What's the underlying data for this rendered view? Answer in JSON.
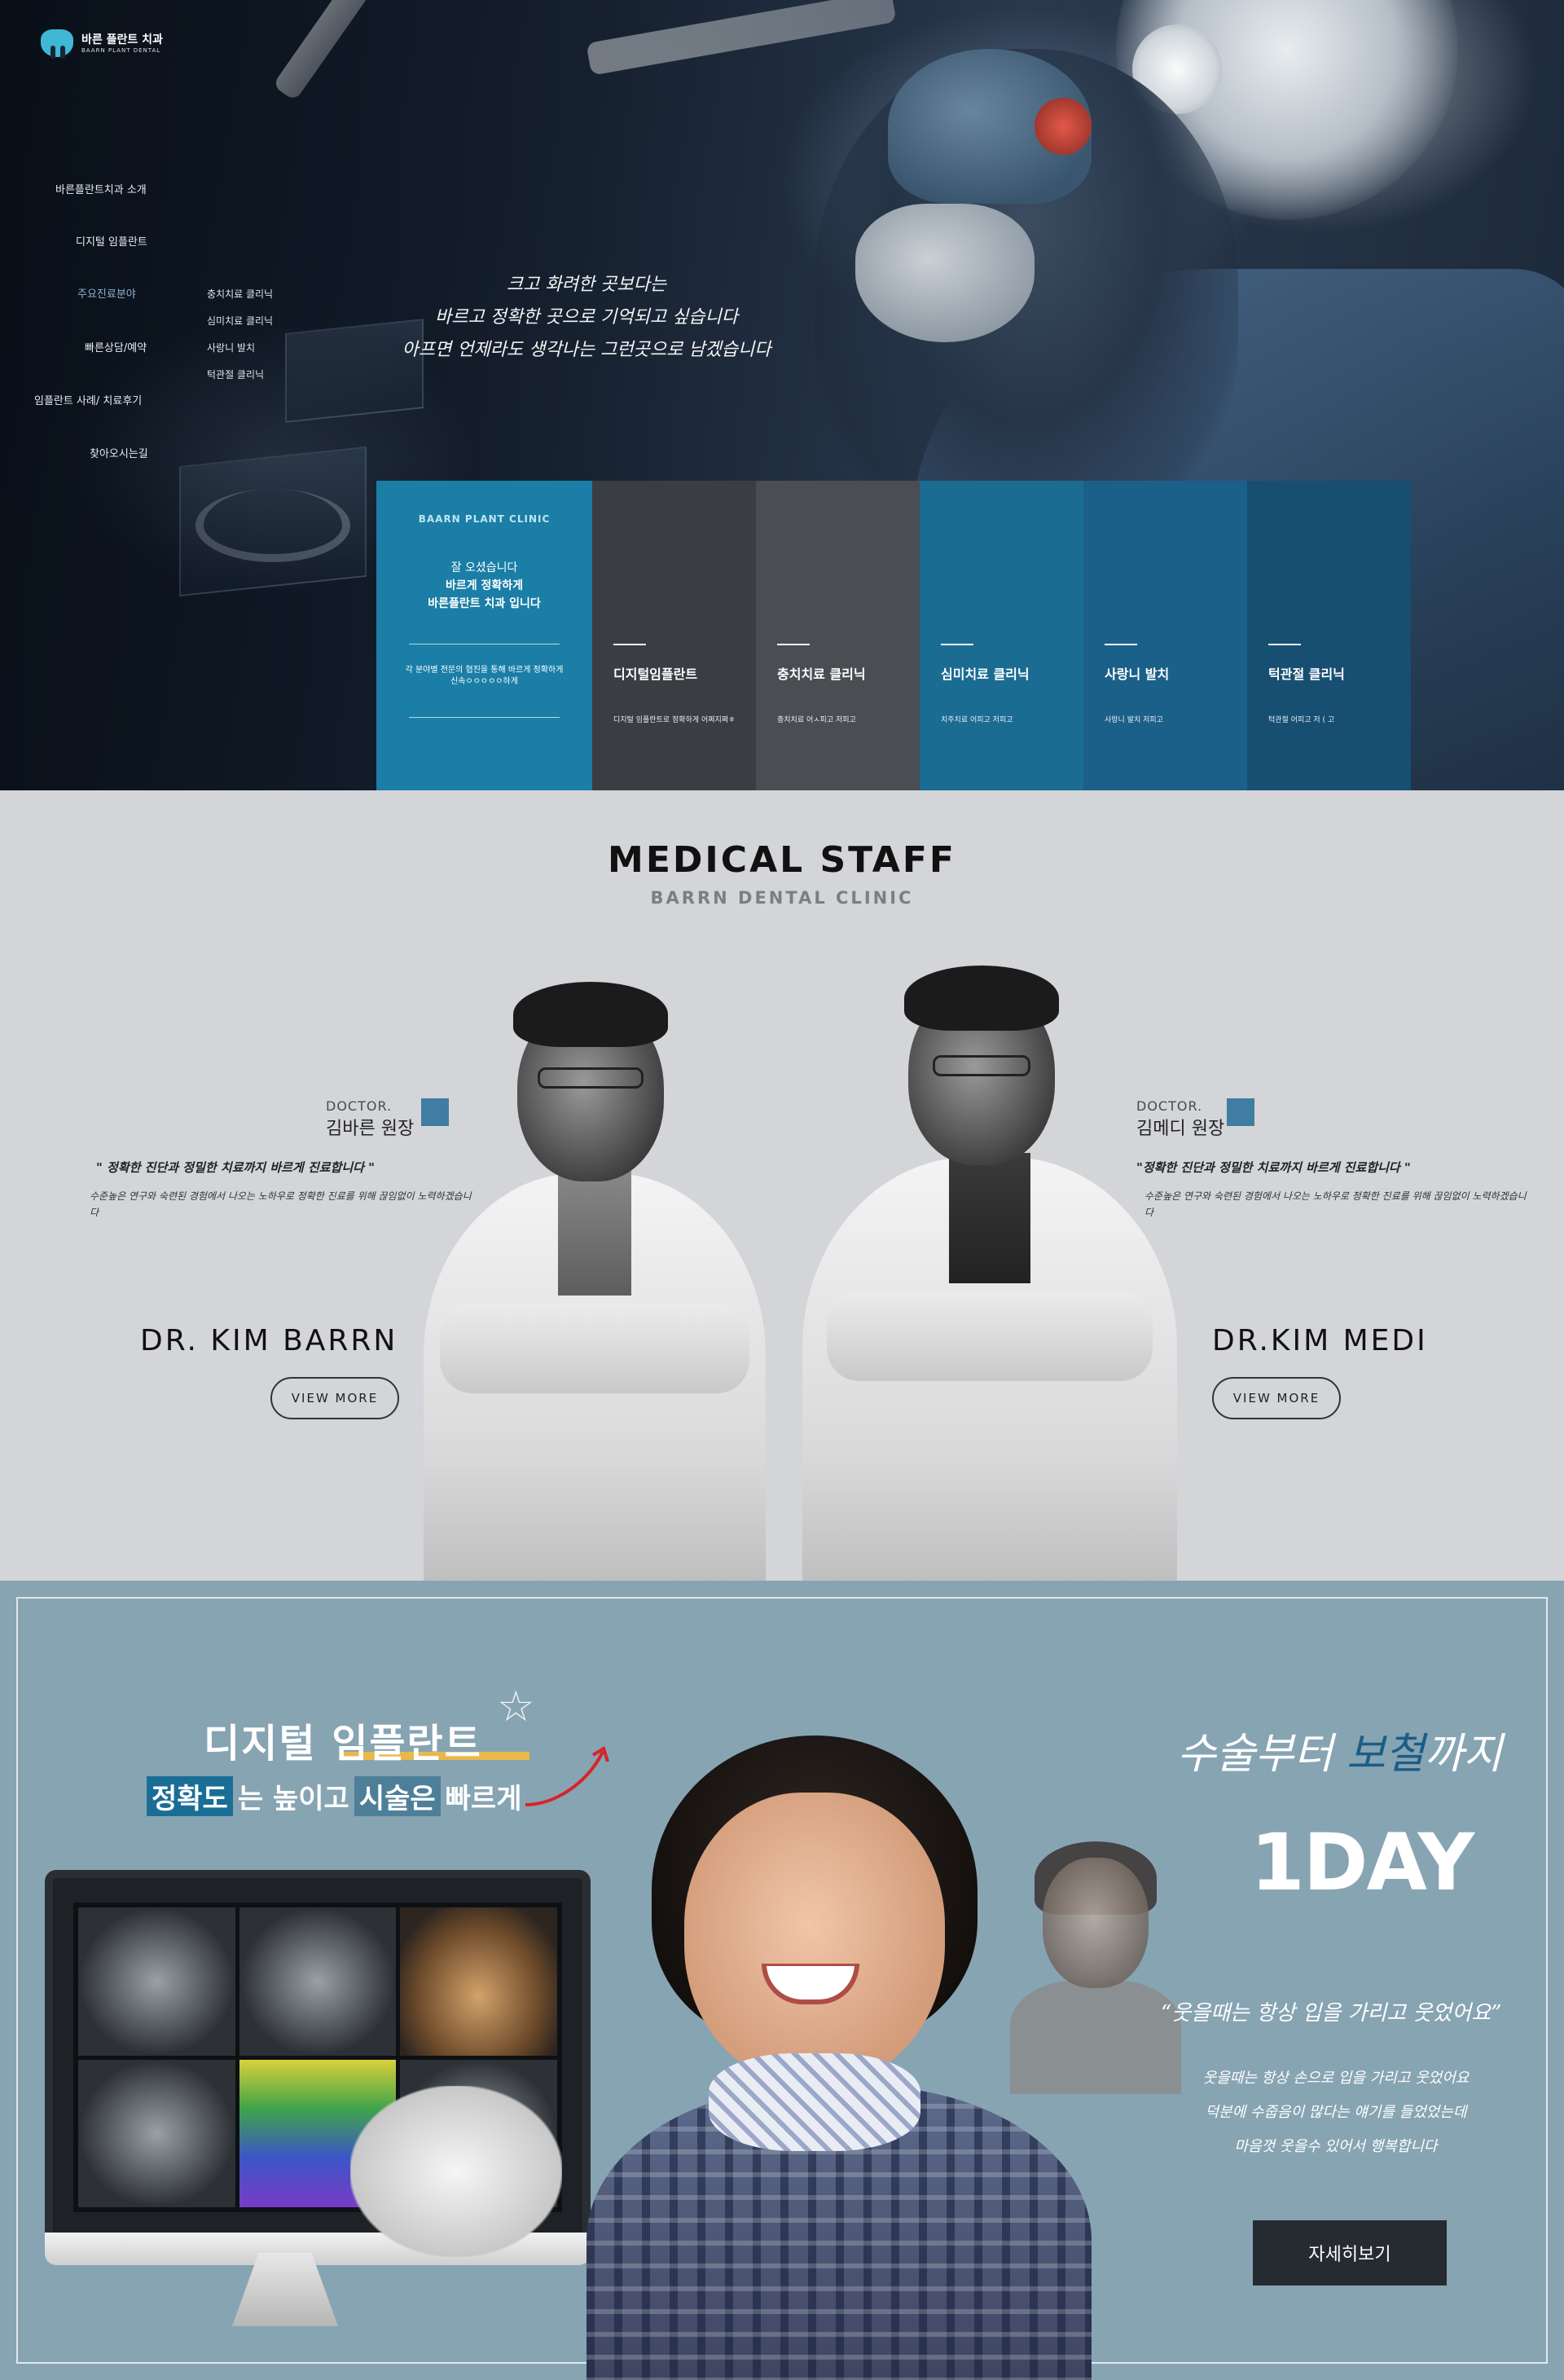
{
  "brand": {
    "kr": "바른 플란트 치과",
    "en": "BAARN PLANT DENTAL"
  },
  "nav": {
    "items": [
      "바른플란트치과 소개",
      "디지털 임플란트",
      "주요진료분야",
      "빠른상담/예약",
      "임플란트 사례/ 치료후기",
      "찾아오시는길"
    ],
    "sub_items": [
      "충치치료 클리닉",
      "심미치료 클리닉",
      "사랑니 발치",
      "턱관절 클리닉"
    ]
  },
  "hero": {
    "quote_lines": [
      "크고 화려한 곳보다는",
      "바르고 정확한 곳으로 기억되고 싶습니다",
      "아프면 언제라도 생각나는 그런곳으로 남겠습니다"
    ],
    "main_card": {
      "brand": "BAARN PLANT CLINIC",
      "l1": "잘 오셨습니다",
      "l2": "바르게 정확하게",
      "l3": "바른플란트 치과 입니다",
      "desc": "각 분야별 전문의 협진을 통해 바르게 정확하게 신속ㅇㅇㅇㅇㅇ하게"
    },
    "cards": [
      {
        "title": "디지털임플란트",
        "desc": "디지털 임플란트로 정확하게 어쩌지쩌ㅎ",
        "color": "#3a3d42"
      },
      {
        "title": "충치치료 클리닉",
        "desc": "충치치료 어ㅅ피고 저피고",
        "color": "#4a4d52"
      },
      {
        "title": "심미치료 클리닉",
        "desc": "치주치료 어피고 저피고",
        "color": "#1a6c93"
      },
      {
        "title": "사랑니 발치",
        "desc": "사랑니 발치 저피고",
        "color": "#1b6089"
      },
      {
        "title": "턱관절 클리닉",
        "desc": "턱관절 어피고 저 ( 고",
        "color": "#174f73"
      }
    ]
  },
  "staff": {
    "title": "MEDICAL STAFF",
    "subtitle": "BARRN DENTAL CLINIC",
    "doctors": [
      {
        "label": "DOCTOR.",
        "name": "김바른 원장",
        "quote": "\" 정확한 진단과 정밀한 치료까지 바르게 진료합니다 \"",
        "desc": "수준높은 연구와 숙련된 경험에서 나오는 노하우로 정확한 진료를 위해 끊임없이 노력하겠습니다",
        "en_name": "DR. KIM BARRN",
        "button": "VIEW MORE"
      },
      {
        "label": "DOCTOR.",
        "name": "김메디 원장",
        "quote": "\"정확한 진단과 정밀한 치료까지 바르게 진료합니다 \"",
        "desc": "수준높은 연구와 숙련된 경험에서 나오는 노하우로 정확한 진료를 위해 끊임없이 노력하겠습니다",
        "en_name": "DR.KIM MEDI",
        "button": "VIEW MORE"
      }
    ]
  },
  "implant": {
    "title": "디지털 임플란트",
    "sub_parts": [
      "정확도",
      "는 높이고 ",
      "시술은",
      " 빠르게"
    ],
    "hero_parts": [
      "수술부터 ",
      "보철",
      "까지"
    ],
    "oneday": "1DAY",
    "testimonial": "“웃을때는 항상 입을 가리고 웃었어요”",
    "testi_lines": [
      "웃을때는 항상 손으로 입을 가리고 웃었어요",
      "덕분에 수줍음이 많다는 얘기를 들었었는데",
      "마음껏 웃을수 있어서 행복합니다"
    ],
    "button": "자세히보기"
  },
  "colors": {
    "accent": "#1a7ea6",
    "staff_bg": "#d3d5d8",
    "implant_bg": "#87a4b3",
    "dark_button": "#262b31"
  }
}
